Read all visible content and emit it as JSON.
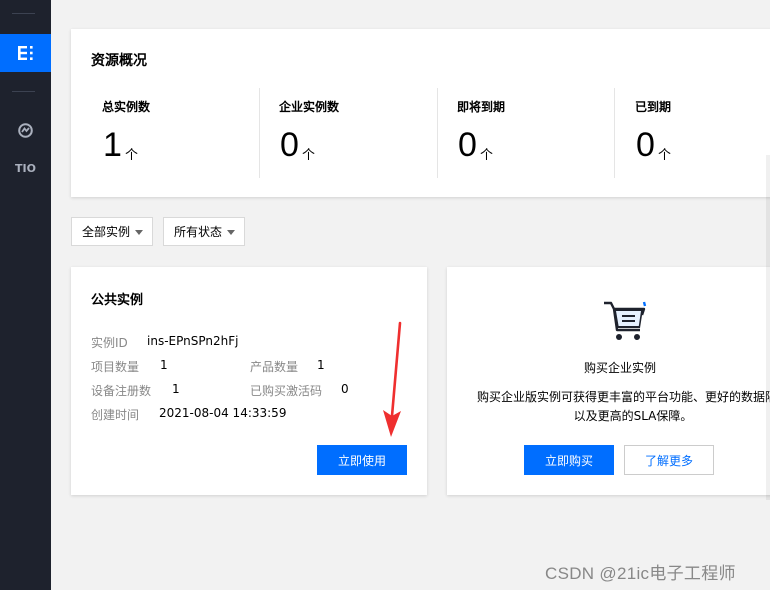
{
  "sidebar": {
    "active_icon": "grid-icon",
    "items": [
      {
        "icon": "badge-icon"
      },
      {
        "label": "TIO"
      }
    ]
  },
  "overview": {
    "title": "资源概况",
    "stats": [
      {
        "label": "总实例数",
        "value": "1",
        "unit": "个"
      },
      {
        "label": "企业实例数",
        "value": "0",
        "unit": "个"
      },
      {
        "label": "即将到期",
        "value": "0",
        "unit": "个"
      },
      {
        "label": "已到期",
        "value": "0",
        "unit": "个"
      }
    ]
  },
  "filters": {
    "instance_type": "全部实例",
    "status": "所有状态"
  },
  "public_instance": {
    "title": "公共实例",
    "instance_id_label": "实例ID",
    "instance_id": "ins-EPnSPn2hFj",
    "project_count_label": "项目数量",
    "project_count": "1",
    "product_count_label": "产品数量",
    "product_count": "1",
    "device_count_label": "设备注册数",
    "device_count": "1",
    "activation_label": "已购买激活码",
    "activation_count": "0",
    "created_label": "创建时间",
    "created_time": "2021-08-04 14:33:59",
    "use_button": "立即使用"
  },
  "enterprise": {
    "icon": "cart-icon",
    "title": "购买企业实例",
    "description_line1": "购买企业版实例可获得更丰富的平台功能、更好的数据隔",
    "description_line2": "以及更高的SLA保障。",
    "buy_button": "立即购买",
    "learn_button": "了解更多"
  },
  "colors": {
    "primary": "#006eff",
    "sidebar_bg": "#1e222d",
    "annotation_arrow": "#ef2f2f"
  },
  "watermark": "CSDN @21ic电子工程师"
}
